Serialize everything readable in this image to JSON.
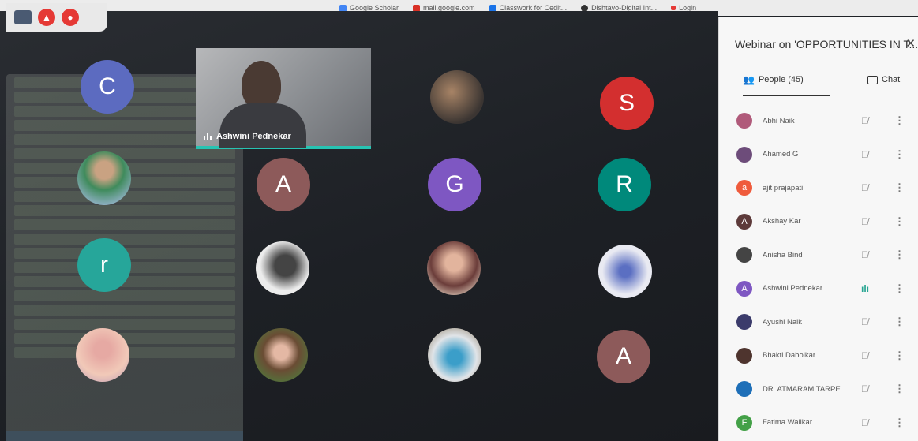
{
  "bookmarks": [
    {
      "label": "Google Scholar",
      "color": "#4285f4"
    },
    {
      "label": "mail.google.com",
      "color": "#d93025"
    },
    {
      "label": "Classwork for Cedit...",
      "color": "#1a73e8"
    },
    {
      "label": "Dishtavo-Digital Int...",
      "color": "#333333"
    },
    {
      "label": "Login",
      "color": "#e53935"
    }
  ],
  "presenter": {
    "name": "Ashwini Pednekar",
    "accent": "#27c3b2"
  },
  "tiles": [
    {
      "letter": "C",
      "color": "#5c6bc0"
    },
    {
      "letter": "S",
      "color": "#d32f2f"
    },
    {
      "letter": "A",
      "color": "#8d5a5a"
    },
    {
      "letter": "G",
      "color": "#7e57c2"
    },
    {
      "letter": "R",
      "color": "#00897b"
    },
    {
      "letter": "r",
      "color": "#26a69a"
    },
    {
      "letter": "A",
      "color": "#8d5a5a"
    }
  ],
  "panel": {
    "title": "Webinar on 'OPPORTUNITIES IN T...",
    "people_tab": "People (45)",
    "chat_tab": "Chat",
    "people": [
      {
        "name": "Abhi Naik",
        "initial": "",
        "color": "#b05a7a",
        "mic": "muted"
      },
      {
        "name": "Ahamed G",
        "initial": "",
        "color": "#6d4c7a",
        "mic": "muted"
      },
      {
        "name": "ajit prajapati",
        "initial": "a",
        "color": "#ef5b3c",
        "mic": "muted"
      },
      {
        "name": "Akshay Kar",
        "initial": "A",
        "color": "#5d3a3a",
        "mic": "muted"
      },
      {
        "name": "Anisha Bind",
        "initial": "",
        "color": "#444444",
        "mic": "muted"
      },
      {
        "name": "Ashwini Pednekar",
        "initial": "A",
        "color": "#7e57c2",
        "mic": "speaking"
      },
      {
        "name": "Ayushi Naik",
        "initial": "",
        "color": "#3b3b6b",
        "mic": "muted"
      },
      {
        "name": "Bhakti Dabolkar",
        "initial": "",
        "color": "#4e342e",
        "mic": "muted"
      },
      {
        "name": "DR. ATMARAM TARPE",
        "initial": "",
        "color": "#1e6fb8",
        "mic": "muted"
      },
      {
        "name": "Fatima Walikar",
        "initial": "F",
        "color": "#43a047",
        "mic": "muted"
      }
    ]
  }
}
